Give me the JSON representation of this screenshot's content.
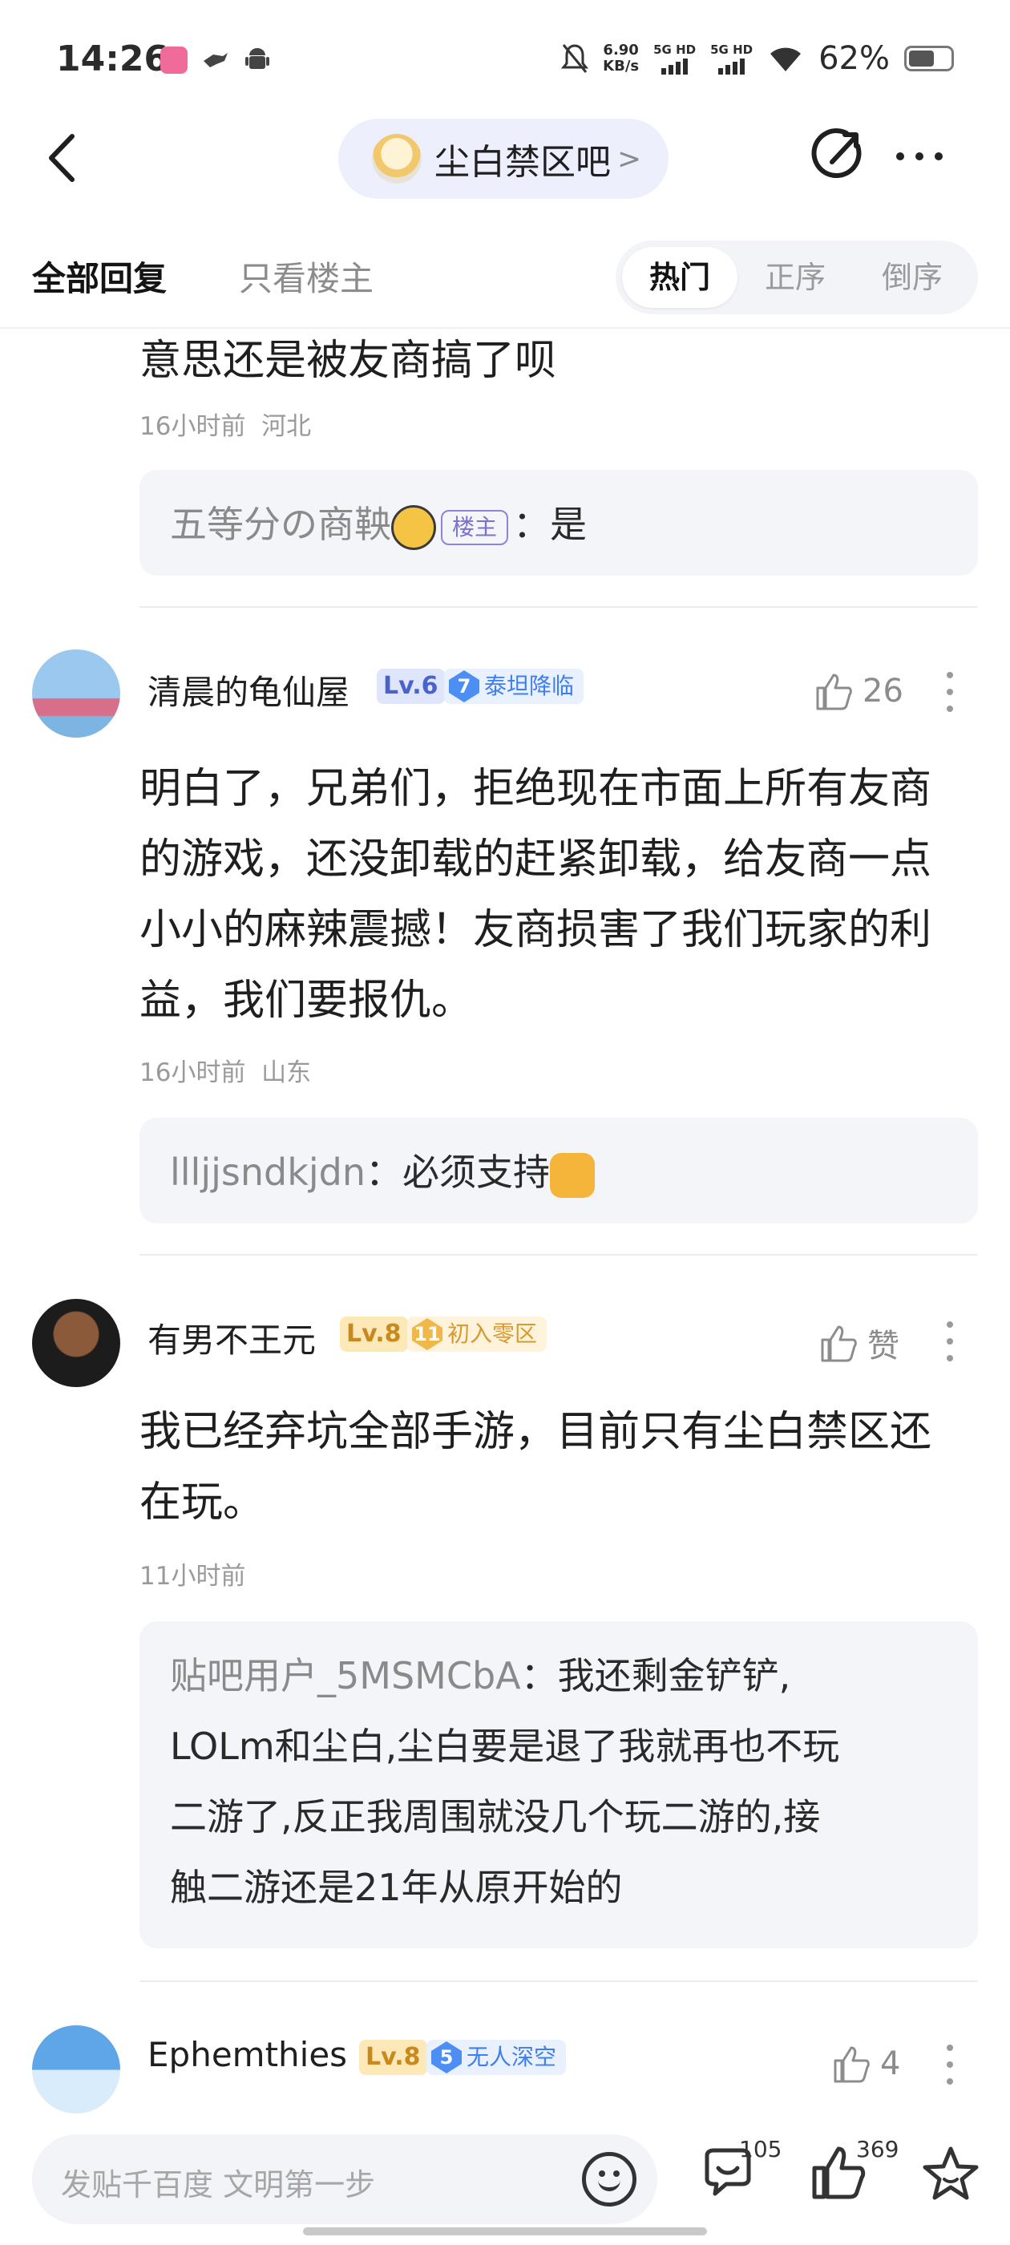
{
  "status_bar": {
    "time": "14:26",
    "app_icons": [
      "lofter-icon",
      "bird-icon",
      "android-icon"
    ],
    "net_speed_value": "6.90",
    "net_speed_unit": "KB/s",
    "sim1_label": "5G HD",
    "sim2_label": "5G HD",
    "battery_percent": "62%",
    "battery_level": 0.62
  },
  "header": {
    "forum_name": "尘白禁区吧",
    "chevron": ">"
  },
  "tabs": {
    "all_replies": "全部回复",
    "op_only": "只看楼主",
    "sort_hot": "热门",
    "sort_asc": "正序",
    "sort_desc": "倒序"
  },
  "posts": [
    {
      "text": "意思还是被友商搞了呗",
      "time": "16小时前",
      "location": "河北",
      "reply": {
        "user": "五等分の商鞅",
        "op_tag": "楼主",
        "separator": "：",
        "text": "是"
      }
    },
    {
      "username": "清晨的龟仙屋",
      "level": "Lv.6",
      "badge_num": "7",
      "badge_text": "泰坦降临",
      "likes": "26",
      "text_lines": [
        "明白了，兄弟们，拒绝现在市面上所有友商",
        "的游戏，还没卸载的赶紧卸载，给友商一点",
        "小小的麻辣震撼！友商损害了我们玩家的利",
        "益，我们要报仇。"
      ],
      "time": "16小时前",
      "location": "山东",
      "reply": {
        "user": "llljjsndkjdn",
        "separator": "：",
        "text": "必须支持"
      }
    },
    {
      "username": "有男不王元",
      "level": "Lv.8",
      "badge_num": "11",
      "badge_text": "初入零区",
      "likes": "赞",
      "text_lines": [
        "我已经弃坑全部手游，目前只有尘白禁区还",
        "在玩。"
      ],
      "time": "11小时前",
      "reply": {
        "user": "贴吧用户_5MSMCbA",
        "separator": "：",
        "text_lines": [
          "我还剩金铲铲,",
          "LOLm和尘白,尘白要是退了我就再也不玩",
          "二游了,反正我周围就没几个玩二游的,接",
          "触二游还是21年从原开始的"
        ]
      }
    },
    {
      "username": "Ephemthies",
      "level": "Lv.8",
      "badge_num": "5",
      "badge_text": "无人深空",
      "likes": "4"
    }
  ],
  "bottom_bar": {
    "input_placeholder": "发贴千百度 文明第一步",
    "comments_count": "105",
    "likes_count": "369"
  },
  "colors": {
    "accent_blue": "#3f7ef0",
    "level_blue": "#4a63c9",
    "level_gold": "#c9891c",
    "op_tag": "#7a72d0",
    "reply_bg": "#f4f5f8"
  }
}
